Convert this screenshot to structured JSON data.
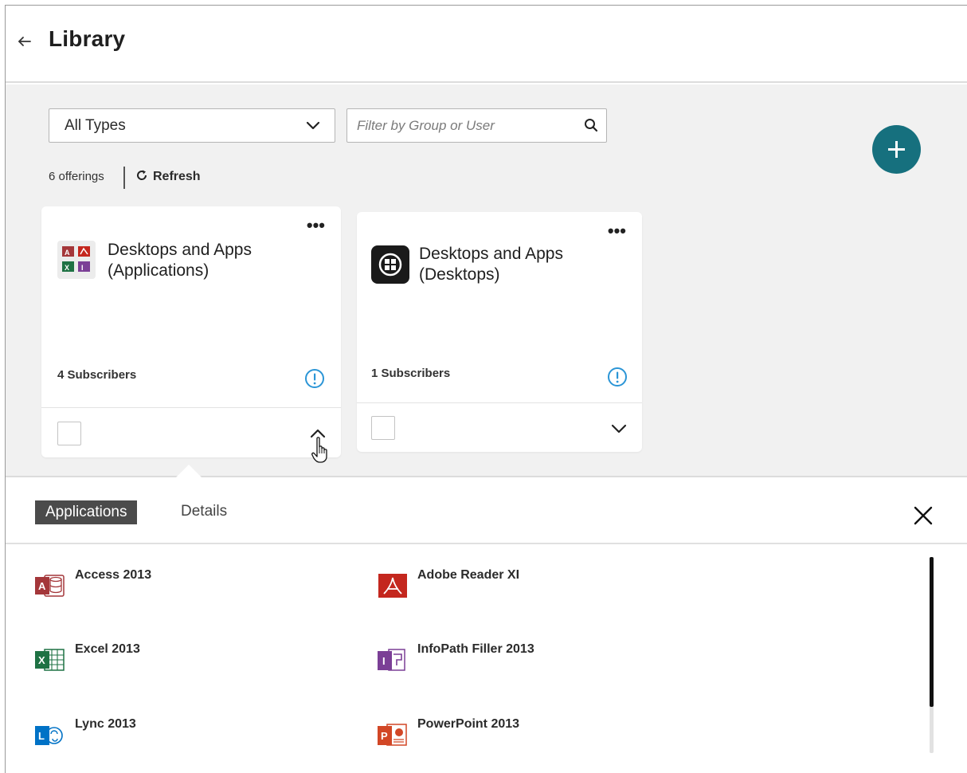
{
  "header": {
    "title": "Library"
  },
  "toolbar": {
    "type_select_value": "All Types",
    "filter_placeholder": "Filter by Group or User",
    "offerings_count": "6 offerings",
    "refresh_label": "Refresh"
  },
  "cards": [
    {
      "title_line1": "Desktops and Apps",
      "title_line2": "(Applications)",
      "subscribers": "4 Subscribers",
      "icon": "office-apps-icon",
      "expanded": true
    },
    {
      "title_line1": "Desktops and Apps",
      "title_line2": "(Desktops)",
      "subscribers": "1 Subscribers",
      "icon": "windows-desktop-icon",
      "expanded": false
    }
  ],
  "panel": {
    "tabs": [
      {
        "label": "Applications",
        "active": true
      },
      {
        "label": "Details",
        "active": false
      }
    ],
    "apps": [
      {
        "name": "Access 2013",
        "icon": "access-icon"
      },
      {
        "name": "Adobe Reader XI",
        "icon": "adobe-reader-icon"
      },
      {
        "name": "Excel 2013",
        "icon": "excel-icon"
      },
      {
        "name": "InfoPath Filler 2013",
        "icon": "infopath-icon"
      },
      {
        "name": "Lync 2013",
        "icon": "lync-icon"
      },
      {
        "name": "PowerPoint 2013",
        "icon": "powerpoint-icon"
      }
    ]
  },
  "colors": {
    "accent": "#16707e",
    "info": "#2b95d6",
    "tab_active_bg": "#4b4b4b",
    "workspace_bg": "#f1f1f1"
  }
}
